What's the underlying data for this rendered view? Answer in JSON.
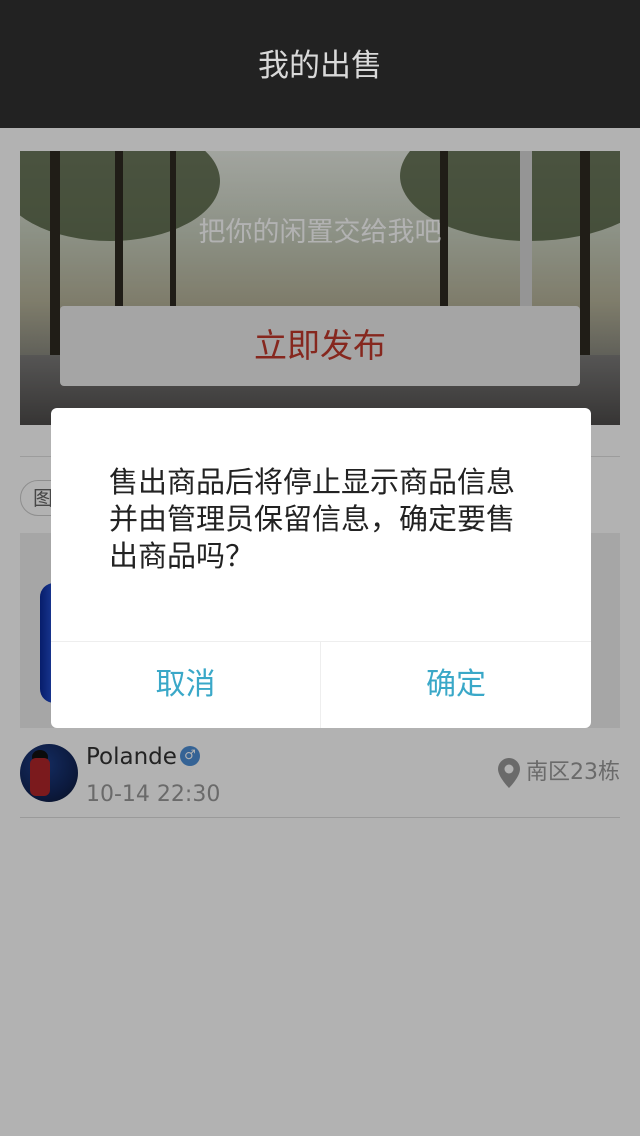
{
  "header": {
    "title": "我的出售"
  },
  "banner": {
    "slogan": "把你的闲置交给我吧",
    "publish_label": "立即发布"
  },
  "listing": {
    "tag": "图",
    "seller_name": "Polande",
    "gender": "♂",
    "time": "10-14 22:30",
    "location": "南区23栋"
  },
  "dialog": {
    "message": "售出商品后将停止显示商品信息并由管理员保留信息，确定要售出商品吗？",
    "cancel_label": "取消",
    "confirm_label": "确定"
  },
  "colors": {
    "header_bg": "#222222",
    "publish_text": "#c0392b",
    "dialog_button_text": "#3aa8c8",
    "overlay": "rgba(0,0,0,0.3)"
  },
  "icons": [
    "location-pin-icon",
    "male-icon"
  ]
}
